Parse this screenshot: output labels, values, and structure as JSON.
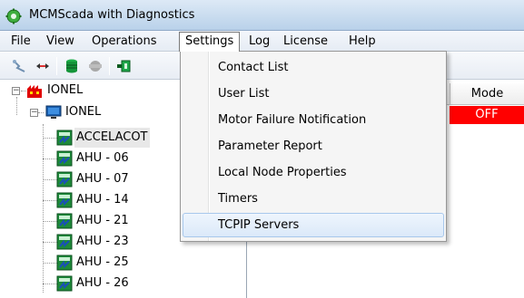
{
  "window": {
    "title": "MCMScada with Diagnostics"
  },
  "menubar": {
    "items": [
      "File",
      "View",
      "Operations",
      "Settings",
      "Log",
      "License",
      "Help"
    ]
  },
  "settings_menu": {
    "items": [
      "Contact List",
      "User List",
      "Motor Failure Notification",
      "Parameter Report",
      "Local Node Properties",
      "Timers",
      "TCPIP Servers"
    ],
    "highlighted": "TCPIP Servers"
  },
  "tree": {
    "root": "IONEL",
    "child": "IONEL",
    "nodes": [
      "ACCELACOT",
      "AHU - 06",
      "AHU - 07",
      "AHU - 14",
      "AHU - 21",
      "AHU - 23",
      "AHU - 25",
      "AHU - 26"
    ]
  },
  "grid": {
    "mode_header": "Mode",
    "mode_value": "OFF"
  },
  "colors": {
    "mode_off": "#ff0000",
    "highlight_border": "#a8c8ec"
  }
}
